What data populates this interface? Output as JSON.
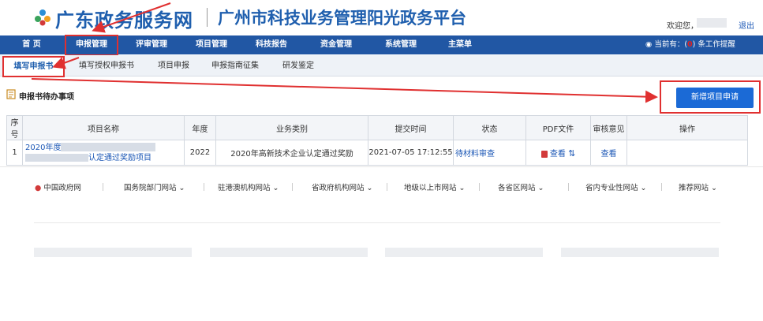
{
  "header": {
    "site_name": "广东政务服务网",
    "platform_name": "广州市科技业务管理阳光政务平台",
    "welcome": "欢迎您，",
    "logout": "退出",
    "logo_color": "#1f5fae"
  },
  "nav": {
    "items": [
      "首 页",
      "申报管理",
      "评审管理",
      "项目管理",
      "科技报告",
      "资金管理",
      "系统管理",
      "主菜单"
    ],
    "notice_prefix": "当前有：(",
    "notice_count": "0",
    "notice_suffix": ") 条工作提醒",
    "bg_color": "#2157a4"
  },
  "subnav": {
    "items": [
      "填写申报书",
      "填写授权申报书",
      "项目申报",
      "申报指南征集",
      "研发鉴定"
    ]
  },
  "section": {
    "title": "申报书待办事项",
    "new_button": "新增项目申请"
  },
  "table": {
    "headers": [
      "序号",
      "项目名称",
      "年度",
      "业务类别",
      "提交时间",
      "状态",
      "PDF文件",
      "审核意见",
      "操作"
    ],
    "rows": [
      {
        "index": "1",
        "name_line1": "2020年度",
        "name_line2": "认定通过奖励项目",
        "year": "2022",
        "category": "2020年高新技术企业认定通过奖励",
        "submit_time": "2021-07-05 17:12:55",
        "status": "待材料审查",
        "pdf": "查看",
        "review": "查看"
      }
    ]
  },
  "footer": {
    "links": [
      "中国政府网",
      "国务院部门网站",
      "驻港澳机构网站",
      "省政府机构网站",
      "地级以上市网站",
      "各省区网站",
      "省内专业性网站",
      "推荐网站"
    ]
  }
}
